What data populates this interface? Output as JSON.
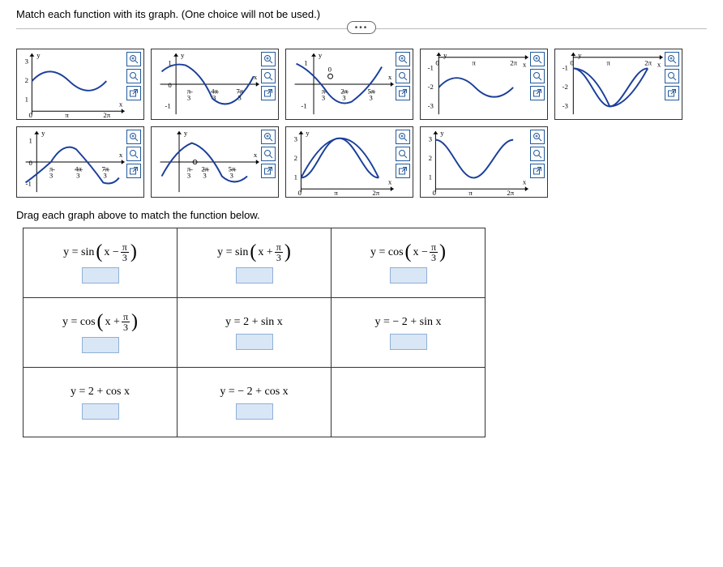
{
  "prompt": "Match each function with its graph. (One choice will not be used.)",
  "drag_label": "Drag each graph above to match the function below.",
  "graphs": [
    {
      "id": 1,
      "x_range": [
        0,
        6.2832
      ],
      "y_range": [
        0,
        3
      ],
      "x_ticks": [
        "π",
        "2π"
      ],
      "y_ticks": [
        "1",
        "2",
        "3"
      ],
      "function": "2 + sin x"
    },
    {
      "id": 2,
      "x_range": [
        -1.047,
        2.618
      ],
      "y_range": [
        -1,
        1
      ],
      "x_ticks": [
        "π/3",
        "4π/3",
        "7π/3"
      ],
      "y_ticks": [
        "-1",
        "0",
        "1"
      ],
      "function": "sin(x + π/3)"
    },
    {
      "id": 3,
      "x_range": [
        -1.047,
        2.094
      ],
      "y_range": [
        -1,
        1
      ],
      "x_ticks": [
        "π/3",
        "2π/3",
        "5π/3"
      ],
      "y_ticks": [
        "-1",
        "0",
        "1"
      ],
      "function": "cos(x + π/3)"
    },
    {
      "id": 4,
      "x_range": [
        0,
        6.2832
      ],
      "y_range": [
        -3,
        -1
      ],
      "x_ticks": [
        "π",
        "2π"
      ],
      "y_ticks": [
        "-3",
        "-2",
        "-1"
      ],
      "function": "-2 + sin x"
    },
    {
      "id": 5,
      "x_range": [
        0,
        6.2832
      ],
      "y_range": [
        -3,
        -1
      ],
      "x_ticks": [
        "π",
        "2π"
      ],
      "y_ticks": [
        "-3",
        "-2",
        "-1"
      ],
      "function": "-2 + cos x"
    },
    {
      "id": 6,
      "x_range": [
        -1.047,
        2.618
      ],
      "y_range": [
        -1,
        1
      ],
      "x_ticks": [
        "π/3",
        "4π/3",
        "7π/3"
      ],
      "y_ticks": [
        "-1",
        "0",
        "1"
      ],
      "function": "sin(x - π/3)"
    },
    {
      "id": 7,
      "x_range": [
        -1.047,
        2.094
      ],
      "y_range": [
        -1,
        1
      ],
      "x_ticks": [
        "π/3",
        "2π/3",
        "5π/3"
      ],
      "y_ticks": [
        "-1",
        "0",
        "1"
      ],
      "function": "cos(x - π/3)"
    },
    {
      "id": 8,
      "x_range": [
        0,
        6.2832
      ],
      "y_range": [
        1,
        3
      ],
      "x_ticks": [
        "π",
        "2π"
      ],
      "y_ticks": [
        "1",
        "2",
        "3"
      ],
      "function": "distractor"
    },
    {
      "id": 9,
      "x_range": [
        0,
        6.2832
      ],
      "y_range": [
        1,
        3
      ],
      "x_ticks": [
        "π",
        "2π"
      ],
      "y_ticks": [
        "1",
        "2",
        "3"
      ],
      "function": "2 + cos x"
    }
  ],
  "targets": {
    "r1": [
      "y = sin(x − π/3)",
      "y = sin(x + π/3)",
      "y = cos(x − π/3)"
    ],
    "r2": [
      "y = cos(x + π/3)",
      "y = 2 + sin x",
      "y = −2 + sin x"
    ],
    "r3": [
      "y = 2 + cos x",
      "y = −2 + cos x",
      ""
    ]
  },
  "tool_icons": [
    "zoom-in",
    "zoom-reset",
    "open-external"
  ],
  "colors": {
    "curve": "#1a3f99",
    "tool": "#235a9b",
    "dropzone": "#d9e6f5"
  },
  "chart_data": [
    {
      "type": "line",
      "title": "",
      "xlim": [
        0,
        6.2832
      ],
      "ylim": [
        0,
        3
      ],
      "series": [
        {
          "name": "curve",
          "expr": "2+sin(x)"
        }
      ],
      "xticks": [
        {
          "v": 3.1416,
          "l": "π"
        },
        {
          "v": 6.2832,
          "l": "2π"
        }
      ],
      "yticks": [
        1,
        2,
        3
      ]
    },
    {
      "type": "line",
      "title": "",
      "xlim": [
        -1.2,
        2.62
      ],
      "ylim": [
        -1,
        1
      ],
      "series": [
        {
          "name": "curve",
          "expr": "sin(x+π/3)"
        }
      ],
      "xticks": [
        {
          "v": 1.047,
          "l": "π/3"
        },
        {
          "v": 1.396,
          "l": "4π/3"
        },
        {
          "v": 2.443,
          "l": "7π/3"
        }
      ],
      "yticks": [
        -1,
        0,
        1
      ]
    },
    {
      "type": "line",
      "title": "",
      "xlim": [
        -1.2,
        2.1
      ],
      "ylim": [
        -1,
        1
      ],
      "series": [
        {
          "name": "curve",
          "expr": "cos(x+π/3)"
        }
      ],
      "xticks": [
        {
          "v": 1.047,
          "l": "π/3"
        },
        {
          "v": 0.698,
          "l": "2π/3"
        },
        {
          "v": 1.745,
          "l": "5π/3"
        }
      ],
      "yticks": [
        -1,
        0,
        1
      ]
    },
    {
      "type": "line",
      "title": "",
      "xlim": [
        0,
        6.2832
      ],
      "ylim": [
        -3,
        -1
      ],
      "series": [
        {
          "name": "curve",
          "expr": "-2+sin(x)"
        }
      ],
      "xticks": [
        {
          "v": 3.1416,
          "l": "π"
        },
        {
          "v": 6.2832,
          "l": "2π"
        }
      ],
      "yticks": [
        -3,
        -2,
        -1
      ]
    },
    {
      "type": "line",
      "title": "",
      "xlim": [
        0,
        6.2832
      ],
      "ylim": [
        -3,
        -1
      ],
      "series": [
        {
          "name": "curve",
          "expr": "-2+cos(x)"
        }
      ],
      "xticks": [
        {
          "v": 3.1416,
          "l": "π"
        },
        {
          "v": 6.2832,
          "l": "2π"
        }
      ],
      "yticks": [
        -3,
        -2,
        -1
      ]
    },
    {
      "type": "line",
      "title": "",
      "xlim": [
        -1.2,
        2.62
      ],
      "ylim": [
        -1,
        1
      ],
      "series": [
        {
          "name": "curve",
          "expr": "sin(x-π/3)"
        }
      ],
      "xticks": [
        {
          "v": 1.047,
          "l": "π/3"
        },
        {
          "v": 1.396,
          "l": "4π/3"
        },
        {
          "v": 2.443,
          "l": "7π/3"
        }
      ],
      "yticks": [
        -1,
        0,
        1
      ]
    },
    {
      "type": "line",
      "title": "",
      "xlim": [
        -1.2,
        2.1
      ],
      "ylim": [
        -1,
        1
      ],
      "series": [
        {
          "name": "curve",
          "expr": "cos(x-π/3)"
        }
      ],
      "xticks": [
        {
          "v": 1.047,
          "l": "π/3"
        },
        {
          "v": 0.698,
          "l": "2π/3"
        },
        {
          "v": 1.745,
          "l": "5π/3"
        }
      ],
      "yticks": [
        -1,
        0,
        1
      ]
    },
    {
      "type": "line",
      "title": "",
      "xlim": [
        0,
        6.2832
      ],
      "ylim": [
        1,
        3
      ],
      "series": [
        {
          "name": "curve",
          "expr": "distractor"
        }
      ],
      "xticks": [
        {
          "v": 3.1416,
          "l": "π"
        },
        {
          "v": 6.2832,
          "l": "2π"
        }
      ],
      "yticks": [
        1,
        2,
        3
      ]
    },
    {
      "type": "line",
      "title": "",
      "xlim": [
        0,
        6.2832
      ],
      "ylim": [
        1,
        3
      ],
      "series": [
        {
          "name": "curve",
          "expr": "2+cos(x)"
        }
      ],
      "xticks": [
        {
          "v": 3.1416,
          "l": "π"
        },
        {
          "v": 6.2832,
          "l": "2π"
        }
      ],
      "yticks": [
        1,
        2,
        3
      ]
    }
  ]
}
